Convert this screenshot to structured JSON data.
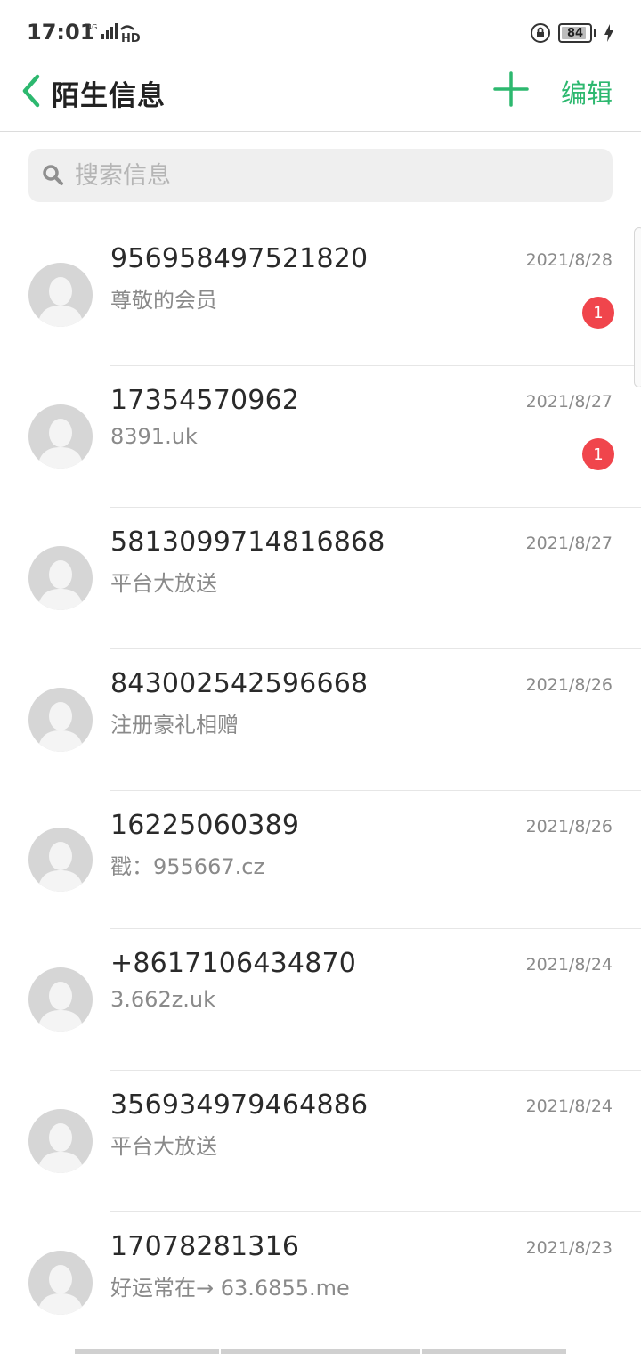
{
  "status_bar": {
    "time": "17:01",
    "network": "4G",
    "hd_label": "HD",
    "battery_level": "84"
  },
  "header": {
    "title": "陌生信息",
    "edit_label": "编辑",
    "accent_color": "#2db86f"
  },
  "search": {
    "placeholder": "搜索信息",
    "value": ""
  },
  "conversations": [
    {
      "sender": "956958497521820",
      "preview": " 尊敬的会员",
      "date": "2021/8/28",
      "unread": "1"
    },
    {
      "sender": "17354570962",
      "preview": "8391.uk",
      "date": "2021/8/27",
      "unread": "1"
    },
    {
      "sender": "5813099714816868",
      "preview": " 平台大放送",
      "date": "2021/8/27",
      "unread": ""
    },
    {
      "sender": "843002542596668",
      "preview": " 注册豪礼相赠",
      "date": "2021/8/26",
      "unread": ""
    },
    {
      "sender": "16225060389",
      "preview": "戳：955667.cz",
      "date": "2021/8/26",
      "unread": ""
    },
    {
      "sender": "+8617106434870",
      "preview": "3.662z.uk",
      "date": "2021/8/24",
      "unread": ""
    },
    {
      "sender": "356934979464886",
      "preview": " 平台大放送",
      "date": "2021/8/24",
      "unread": ""
    },
    {
      "sender": "17078281316",
      "preview": "好运常在→ 63.6855.me",
      "date": "2021/8/23",
      "unread": ""
    }
  ]
}
